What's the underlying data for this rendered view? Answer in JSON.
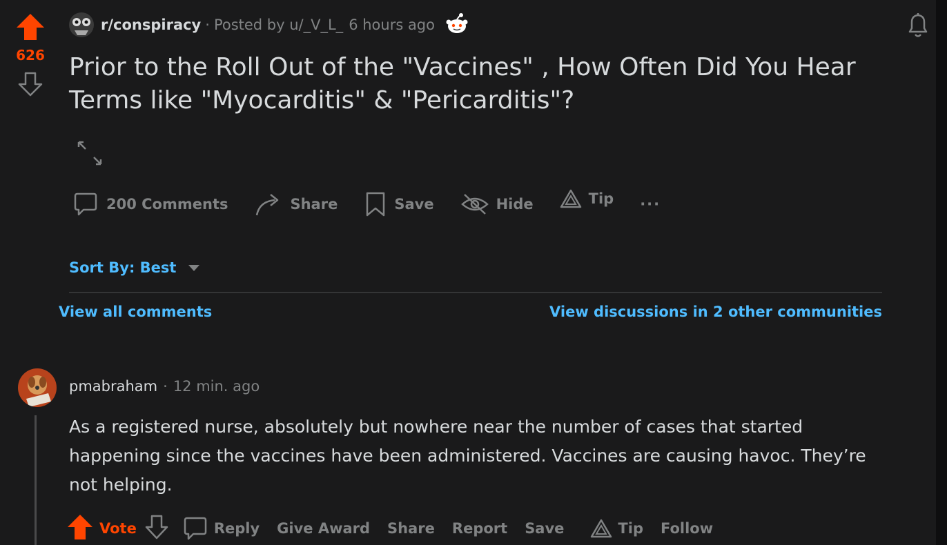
{
  "post": {
    "score": "626",
    "subreddit": "r/conspiracy",
    "meta_separator": "·",
    "posted_by": "Posted by u/_V_L_",
    "time_ago": "6 hours ago",
    "title": "Prior to the Roll Out of the \"Vaccines\" , How Often Did You Hear Terms like \"Myocarditis\" & \"Pericarditis\"?",
    "actions": {
      "comments": "200 Comments",
      "share": "Share",
      "save": "Save",
      "hide": "Hide",
      "tip": "Tip",
      "more": "···"
    }
  },
  "sort": {
    "label": "Sort By: Best"
  },
  "links": {
    "view_all": "View all comments",
    "view_discussions": "View discussions in 2 other communities"
  },
  "comment": {
    "author": "pmabraham",
    "separator": "·",
    "time_ago": "12 min. ago",
    "body": "As a registered nurse, absolutely but nowhere near the number of cases that started happening since the vaccines have been administered. Vaccines are causing havoc. They’re not helping.",
    "actions": {
      "vote": "Vote",
      "reply": "Reply",
      "give_award": "Give Award",
      "share": "Share",
      "report": "Report",
      "save": "Save",
      "tip": "Tip",
      "follow": "Follow"
    }
  },
  "colors": {
    "background": "#1a1a1b",
    "text": "#d7dadc",
    "muted": "#818384",
    "accent_orange": "#ff4500",
    "link_blue": "#4fbcff"
  }
}
